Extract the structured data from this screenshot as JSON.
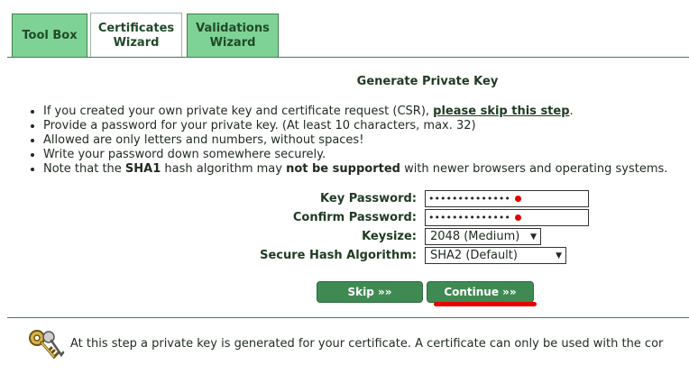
{
  "tabs": [
    {
      "label": "Tool Box"
    },
    {
      "label": "Certificates\nWizard"
    },
    {
      "label": "Validations\nWizard"
    }
  ],
  "heading": "Generate Private Key",
  "info": {
    "item1_text": "If you created your own private key and certificate request (CSR), ",
    "item1_link": "please skip this step",
    "item1_end": ".",
    "item2": "Provide a password for your private key. (At least 10 characters, max. 32)",
    "item3": "Allowed are only letters and numbers, without spaces!",
    "item4": "Write your password down somewhere securely.",
    "item5_a": "Note that the ",
    "item5_b": "SHA1",
    "item5_c": " hash algorithm may ",
    "item5_d": "not be supported",
    "item5_e": " with newer browsers and operating systems."
  },
  "form": {
    "key_password_label": "Key Password:",
    "key_password_value": "••••••••••••••",
    "confirm_password_label": "Confirm Password:",
    "confirm_password_value": "••••••••••••••",
    "keysize_label": "Keysize:",
    "keysize_value": "2048 (Medium)",
    "hash_label": "Secure Hash Algorithm:",
    "hash_value": "SHA2 (Default)"
  },
  "buttons": {
    "skip": "Skip »»",
    "continue": "Continue »»"
  },
  "footer": {
    "text": "At this step a private key is generated for your certificate. A certificate can only be used with the cor"
  },
  "colors": {
    "tab_inactive": "#7fd295",
    "button": "#3f8a52",
    "annotation_red": "#e60000"
  }
}
